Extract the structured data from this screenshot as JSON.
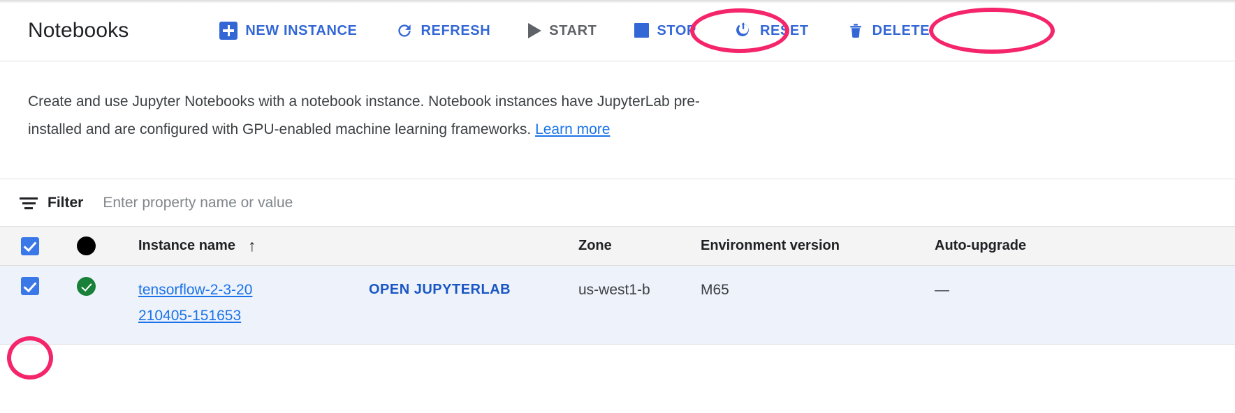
{
  "header": {
    "title": "Notebooks",
    "toolbar": [
      {
        "id": "new-instance",
        "label": "NEW INSTANCE",
        "icon": "plus-box-icon",
        "state": "enabled",
        "annotated": false
      },
      {
        "id": "refresh",
        "label": "REFRESH",
        "icon": "refresh-icon",
        "state": "enabled",
        "annotated": false
      },
      {
        "id": "start",
        "label": "START",
        "icon": "play-icon",
        "state": "disabled",
        "annotated": false
      },
      {
        "id": "stop",
        "label": "STOP",
        "icon": "stop-square-icon",
        "state": "enabled",
        "annotated": true
      },
      {
        "id": "reset",
        "label": "RESET",
        "icon": "power-reset-icon",
        "state": "enabled",
        "annotated": false
      },
      {
        "id": "delete",
        "label": "DELETE",
        "icon": "trash-icon",
        "state": "enabled",
        "annotated": true
      }
    ]
  },
  "description": {
    "text": "Create and use Jupyter Notebooks with a notebook instance. Notebook instances have JupyterLab pre-installed and are configured with GPU-enabled machine learning frameworks. ",
    "link_label": "Learn more"
  },
  "filter": {
    "icon": "filter-icon",
    "label": "Filter",
    "placeholder": "Enter property name or value",
    "value": ""
  },
  "table": {
    "header": {
      "select_all_checked": true,
      "status_icon": "filled-circle-icon",
      "name": "Instance name",
      "sort_arrow": "↑",
      "zone": "Zone",
      "environment_version": "Environment version",
      "auto_upgrade": "Auto-upgrade"
    },
    "rows": [
      {
        "selected": true,
        "status": "running",
        "status_icon": "green-check-circle-icon",
        "name": "tensorflow-2-3-20210405-151653",
        "open_action": "OPEN JUPYTERLAB",
        "zone": "us-west1-b",
        "environment_version": "M65",
        "auto_upgrade": "—"
      }
    ]
  },
  "annotations": {
    "color": "#f4256b",
    "targets": [
      "stop-button",
      "delete-button",
      "row-checkbox"
    ]
  },
  "colors": {
    "accent_blue": "#1a73e8",
    "button_blue": "#3367d6",
    "disabled_gray": "#5f6368",
    "status_green": "#188038",
    "row_selected_bg": "#eef2fb",
    "header_row_bg": "#f4f4f4",
    "annotation_pink": "#f4256b"
  }
}
